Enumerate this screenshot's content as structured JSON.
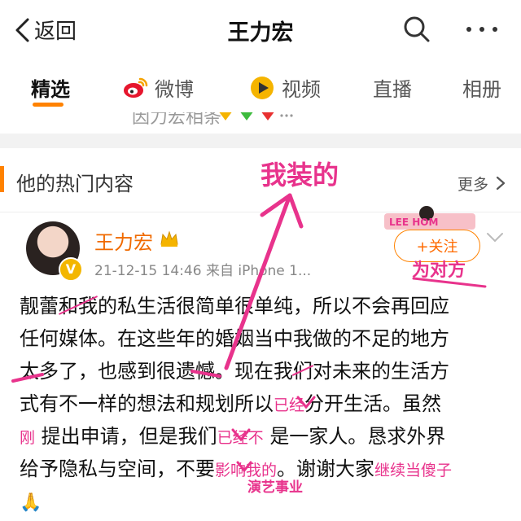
{
  "nav": {
    "back_label": "返回",
    "title": "王力宏"
  },
  "tabs": [
    {
      "label": "精选",
      "active": true
    },
    {
      "label": "微博",
      "icon": "weibo-icon"
    },
    {
      "label": "视频",
      "icon": "video-icon"
    },
    {
      "label": "直播"
    },
    {
      "label": "相册"
    }
  ],
  "partial_text": "因力宏相条",
  "hot_section": {
    "title": "他的热门内容",
    "more_label": "更多"
  },
  "post": {
    "author": "王力宏",
    "meta": "21-12-15 14:46 来自 iPhone 1...",
    "follow_label": "+关注",
    "lines": {
      "l1a": "靓蕾",
      "l1b": "和我",
      "l1c": "的私生活很简单很单纯，所以不会再回应",
      "l2": "任何媒体。在这些年的婚姻当中我做的不足的地方",
      "l3a": "太多了，也感到很遗憾。现在我",
      "l3b": "们",
      "l3c": "对未来的生活方",
      "l4a": "式有不一样的想法和规划所以",
      "l4b": "已经",
      "l4c": "分开生活。虽然",
      "l5a": "刚",
      "l5b": "提出申请，但是我们",
      "l5c": "已经不",
      "l5d": "是一家人。恳求外界",
      "l6a": "给予隐私与空间，不要",
      "l6b": "影响我的",
      "l6c": "。谢谢大家",
      "l6d": "继续当傻子"
    }
  },
  "annotations": {
    "top": "我装的",
    "follow_note": "为对方",
    "bottom": "演艺事业"
  },
  "colors": {
    "accent": "#ff8200",
    "annotation": "#e8338c",
    "author": "#f06a00"
  }
}
